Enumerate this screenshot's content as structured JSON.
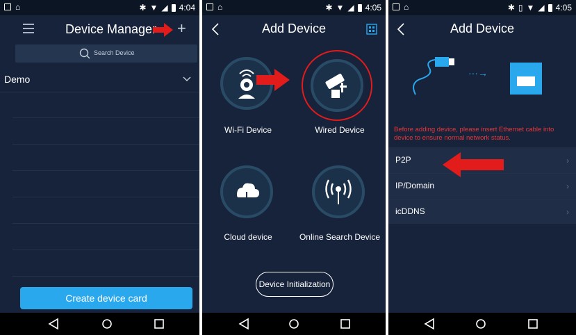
{
  "status": {
    "time1": "4:04",
    "time2": "4:05",
    "time3": "4:05"
  },
  "screen1": {
    "title": "Device Manager",
    "search_placeholder": "Search Device",
    "group_name": "Demo",
    "create_button": "Create device card"
  },
  "screen2": {
    "title": "Add Device",
    "devices": [
      {
        "label": "Wi-Fi Device"
      },
      {
        "label": "Wired Device"
      },
      {
        "label": "Cloud device"
      },
      {
        "label": "Online Search Device"
      }
    ],
    "init_button": "Device Initialization"
  },
  "screen3": {
    "title": "Add Device",
    "warning": "Before adding device, please insert Ethernet cable into device to ensure normal network status.",
    "options": [
      {
        "label": "P2P"
      },
      {
        "label": "IP/Domain"
      },
      {
        "label": "icDDNS"
      }
    ]
  },
  "colors": {
    "background": "#16233a",
    "accent": "#2aa8ee",
    "warning": "#e8373a",
    "highlight": "#e21b1b"
  }
}
